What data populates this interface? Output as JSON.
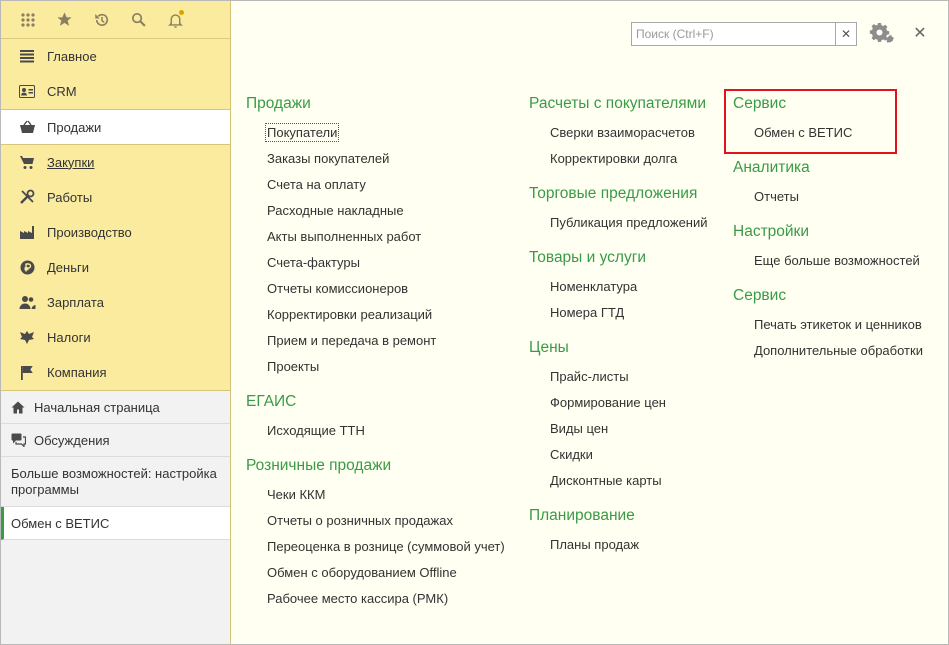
{
  "toolbar": {
    "icons": [
      "apps-icon",
      "star-icon",
      "history-icon",
      "search-icon",
      "bell-icon"
    ]
  },
  "sections": [
    {
      "label": "Главное",
      "icon": "menu-lines-icon"
    },
    {
      "label": "CRM",
      "icon": "contact-card-icon"
    },
    {
      "label": "Продажи",
      "icon": "basket-icon"
    },
    {
      "label": "Закупки",
      "icon": "cart-icon"
    },
    {
      "label": "Работы",
      "icon": "tools-icon"
    },
    {
      "label": "Производство",
      "icon": "factory-icon"
    },
    {
      "label": "Деньги",
      "icon": "ruble-icon"
    },
    {
      "label": "Зарплата",
      "icon": "people-icon"
    },
    {
      "label": "Налоги",
      "icon": "eagle-icon"
    },
    {
      "label": "Компания",
      "icon": "flag-icon"
    }
  ],
  "bottom": {
    "home": "Начальная страница",
    "discussions": "Обсуждения",
    "more": "Больше возможностей: настройка программы",
    "current": "Обмен с ВЕТИС"
  },
  "search": {
    "placeholder": "Поиск (Ctrl+F)",
    "value": ""
  },
  "columns": [
    [
      {
        "title": "Продажи",
        "items": [
          "Покупатели",
          "Заказы покупателей",
          "Счета на оплату",
          "Расходные накладные",
          "Акты выполненных работ",
          "Счета-фактуры",
          "Отчеты комиссионеров",
          "Корректировки реализаций",
          "Прием и передача в ремонт",
          "Проекты"
        ]
      },
      {
        "title": "ЕГАИС",
        "items": [
          "Исходящие ТТН"
        ]
      },
      {
        "title": "Розничные продажи",
        "items": [
          "Чеки ККМ",
          "Отчеты о розничных продажах",
          "Переоценка в рознице (суммовой учет)",
          "Обмен с оборудованием Offline",
          "Рабочее место кассира (РМК)"
        ]
      }
    ],
    [
      {
        "title": "Расчеты с покупателями",
        "items": [
          "Сверки взаиморасчетов",
          "Корректировки долга"
        ]
      },
      {
        "title": "Торговые предложения",
        "items": [
          "Публикация предложений"
        ]
      },
      {
        "title": "Товары и услуги",
        "items": [
          "Номенклатура",
          "Номера ГТД"
        ]
      },
      {
        "title": "Цены",
        "items": [
          "Прайс-листы",
          "Формирование цен",
          "Виды цен",
          "Скидки",
          "Дисконтные карты"
        ]
      },
      {
        "title": "Планирование",
        "items": [
          "Планы продаж"
        ]
      }
    ],
    [
      {
        "title": "Сервис",
        "items": [
          "Обмен с ВЕТИС"
        ]
      },
      {
        "title": "Аналитика",
        "items": [
          "Отчеты"
        ]
      },
      {
        "title": "Настройки",
        "items": [
          "Еще больше возможностей"
        ]
      },
      {
        "title": "Сервис",
        "items": [
          "Печать этикеток и ценников",
          "Дополнительные обработки"
        ]
      }
    ]
  ],
  "colors": {
    "accent": "#3a9b47",
    "panel": "#fbeb9f",
    "highlight": "#e0141e"
  }
}
